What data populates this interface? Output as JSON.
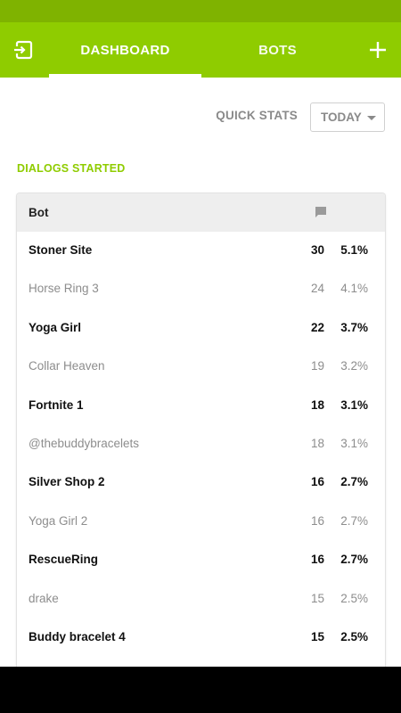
{
  "app_bar": {
    "tabs": [
      {
        "label": "DASHBOARD",
        "active": true
      },
      {
        "label": "BOTS",
        "active": false
      }
    ],
    "exit_icon": "exit-to-app-icon",
    "add_icon": "plus-icon",
    "colors": {
      "accent": "#8fcc00",
      "status_bar": "#7fb300"
    }
  },
  "quick_stats": {
    "label": "QUICK STATS",
    "period": "TODAY"
  },
  "section": {
    "title": "DIALOGS STARTED"
  },
  "table": {
    "header": {
      "bot": "Bot",
      "count_icon": "chat-bubble-icon"
    },
    "rows": [
      {
        "name": "Stoner Site",
        "count": "30",
        "pct": "5.1%"
      },
      {
        "name": "Horse Ring 3",
        "count": "24",
        "pct": "4.1%"
      },
      {
        "name": "Yoga Girl",
        "count": "22",
        "pct": "3.7%"
      },
      {
        "name": "Collar Heaven",
        "count": "19",
        "pct": "3.2%"
      },
      {
        "name": "Fortnite 1",
        "count": "18",
        "pct": "3.1%"
      },
      {
        "name": "@thebuddybracelets",
        "count": "18",
        "pct": "3.1%"
      },
      {
        "name": "Silver Shop 2",
        "count": "16",
        "pct": "2.7%"
      },
      {
        "name": "Yoga Girl 2",
        "count": "16",
        "pct": "2.7%"
      },
      {
        "name": "RescueRing",
        "count": "16",
        "pct": "2.7%"
      },
      {
        "name": "drake",
        "count": "15",
        "pct": "2.5%"
      },
      {
        "name": "Buddy bracelet 4",
        "count": "15",
        "pct": "2.5%"
      }
    ]
  }
}
